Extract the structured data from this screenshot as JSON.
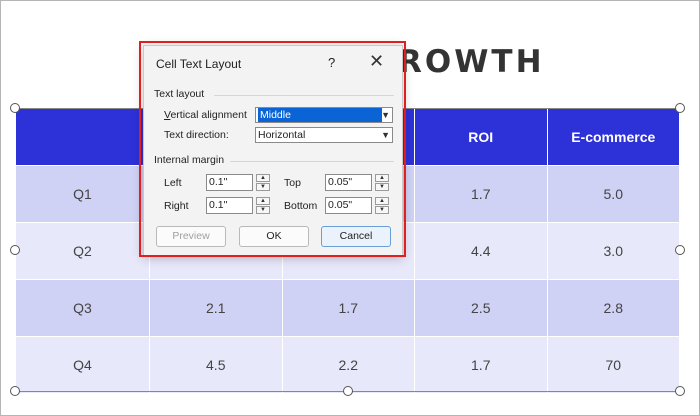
{
  "slide": {
    "title_visible": "ROWTH"
  },
  "table": {
    "headers": [
      "",
      "",
      "",
      "ROI",
      "E-commerce"
    ],
    "rows": [
      [
        "Q1",
        "",
        "",
        "1.7",
        "5.0"
      ],
      [
        "Q2",
        "",
        "",
        "4.4",
        "3.0"
      ],
      [
        "Q3",
        "2.1",
        "1.7",
        "2.5",
        "2.8"
      ],
      [
        "Q4",
        "4.5",
        "2.2",
        "1.7",
        "70"
      ]
    ]
  },
  "dialog": {
    "title": "Cell Text Layout",
    "help": "?",
    "close": "✕",
    "text_layout_section": "Text layout",
    "vertical_alignment_label": "Vertical alignment",
    "vertical_alignment_value": "Middle",
    "text_direction_label": "Text direction:",
    "text_direction_value": "Horizontal",
    "internal_margin_section": "Internal margin",
    "left_label": "Left",
    "left_value": "0.1\"",
    "right_label": "Right",
    "right_value": "0.1\"",
    "top_label": "Top",
    "top_value": "0.05\"",
    "bottom_label": "Bottom",
    "bottom_value": "0.05\"",
    "preview_button": "Preview",
    "ok_button": "OK",
    "cancel_button": "Cancel"
  },
  "colors": {
    "header_bg": "#2d31d8",
    "row_odd": "#cfd1f5",
    "row_even": "#e7e8fa",
    "highlight": "#e01f1f",
    "selected_option": "#0a64d6"
  }
}
